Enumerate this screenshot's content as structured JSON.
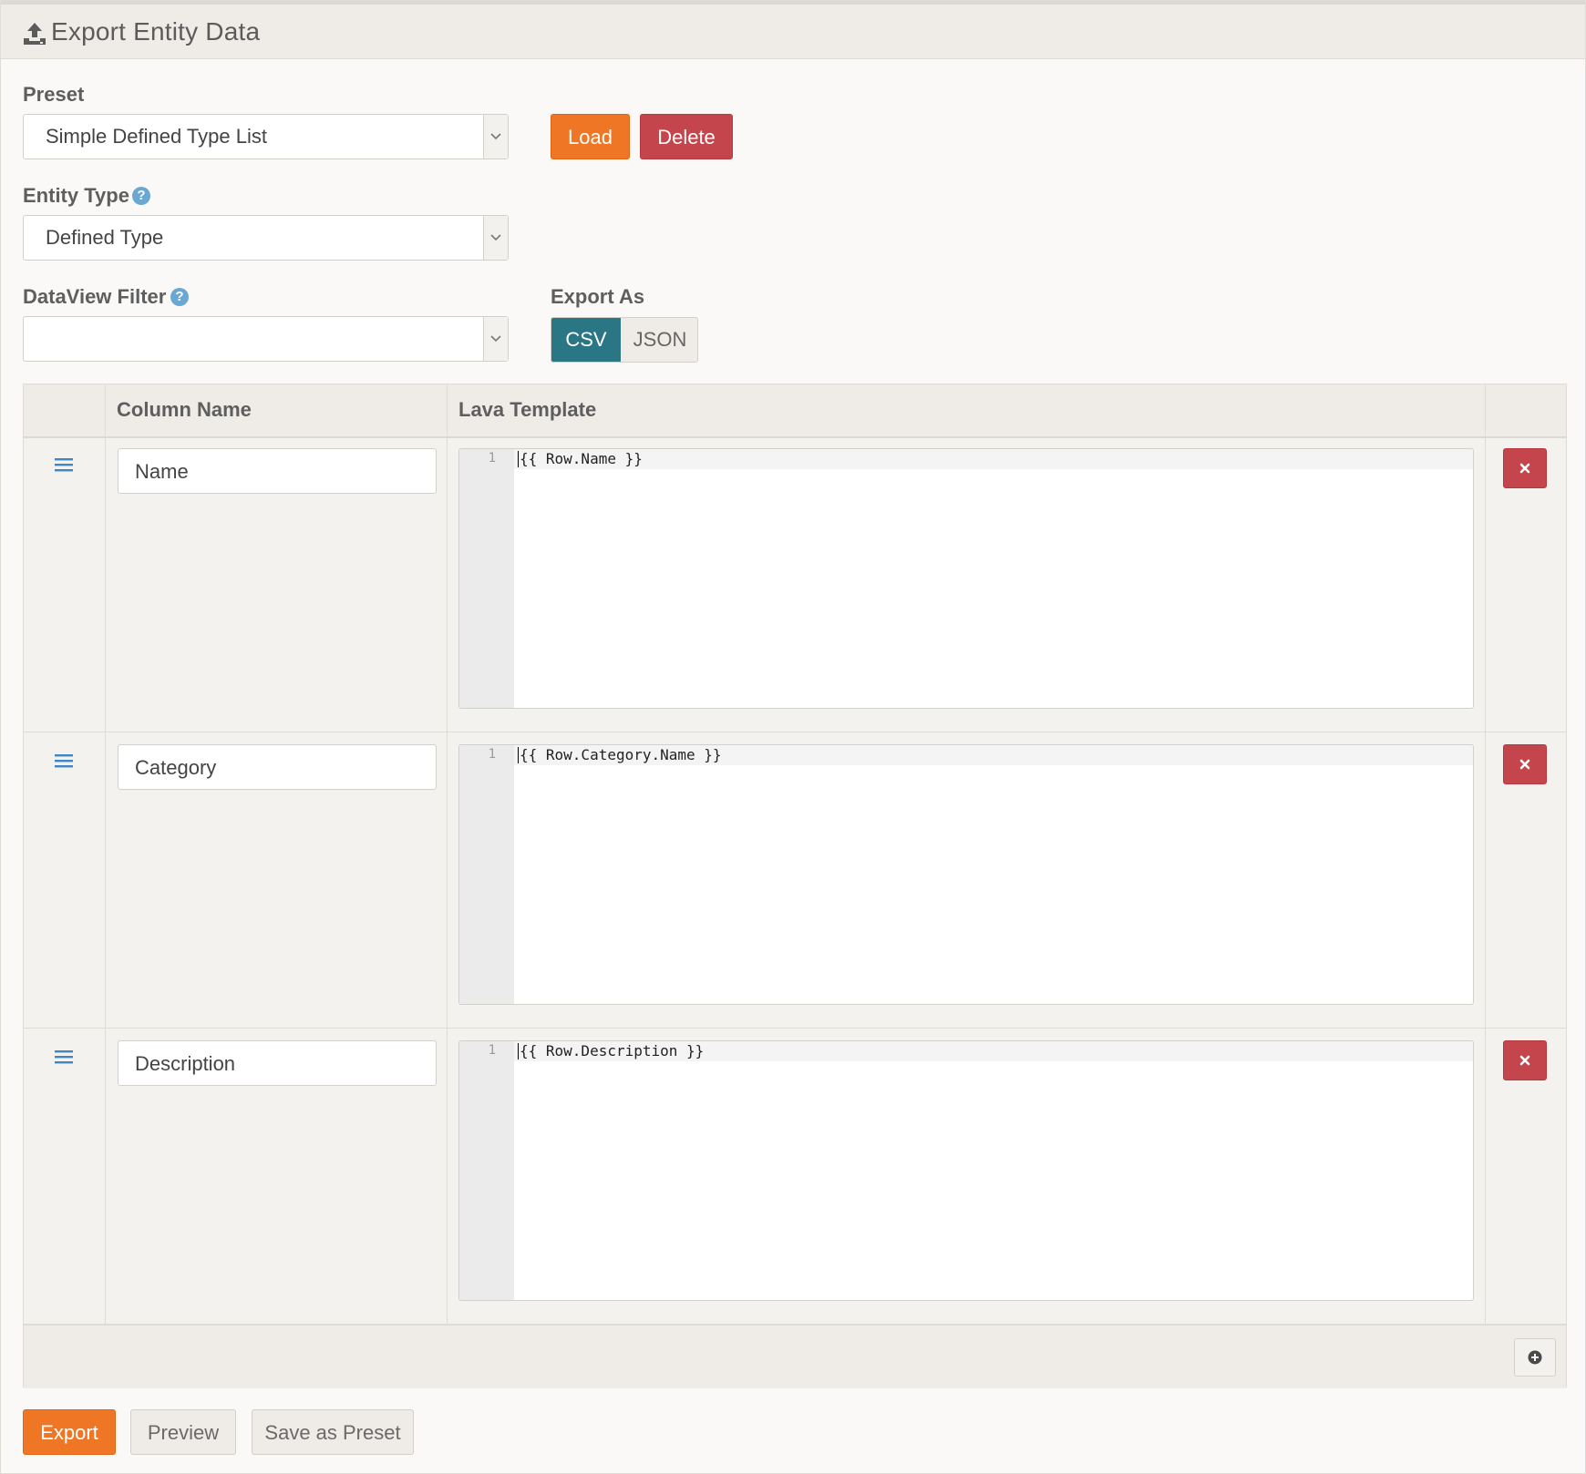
{
  "panel": {
    "title": "Export Entity Data",
    "icon": "upload-icon"
  },
  "preset": {
    "label": "Preset",
    "selected": "Simple Defined Type List",
    "load_label": "Load",
    "delete_label": "Delete"
  },
  "entity_type": {
    "label": "Entity Type",
    "selected": "Defined Type"
  },
  "dataview_filter": {
    "label": "DataView Filter",
    "selected": ""
  },
  "export_as": {
    "label": "Export As",
    "options": [
      "CSV",
      "JSON"
    ],
    "selected": "CSV"
  },
  "grid": {
    "columns": [
      "",
      "Column Name",
      "Lava Template",
      ""
    ],
    "rows": [
      {
        "column_name": "Name",
        "line_number": "1",
        "template": "{{ Row.Name }}"
      },
      {
        "column_name": "Category",
        "line_number": "1",
        "template": "{{ Row.Category.Name }}"
      },
      {
        "column_name": "Description",
        "line_number": "1",
        "template": "{{ Row.Description }}"
      }
    ]
  },
  "actions": {
    "export_label": "Export",
    "preview_label": "Preview",
    "save_preset_label": "Save as Preset"
  },
  "colors": {
    "primary": "#ee7625",
    "danger": "#c4454b",
    "toggle_active": "#2b7684",
    "help": "#6aa7d3"
  }
}
